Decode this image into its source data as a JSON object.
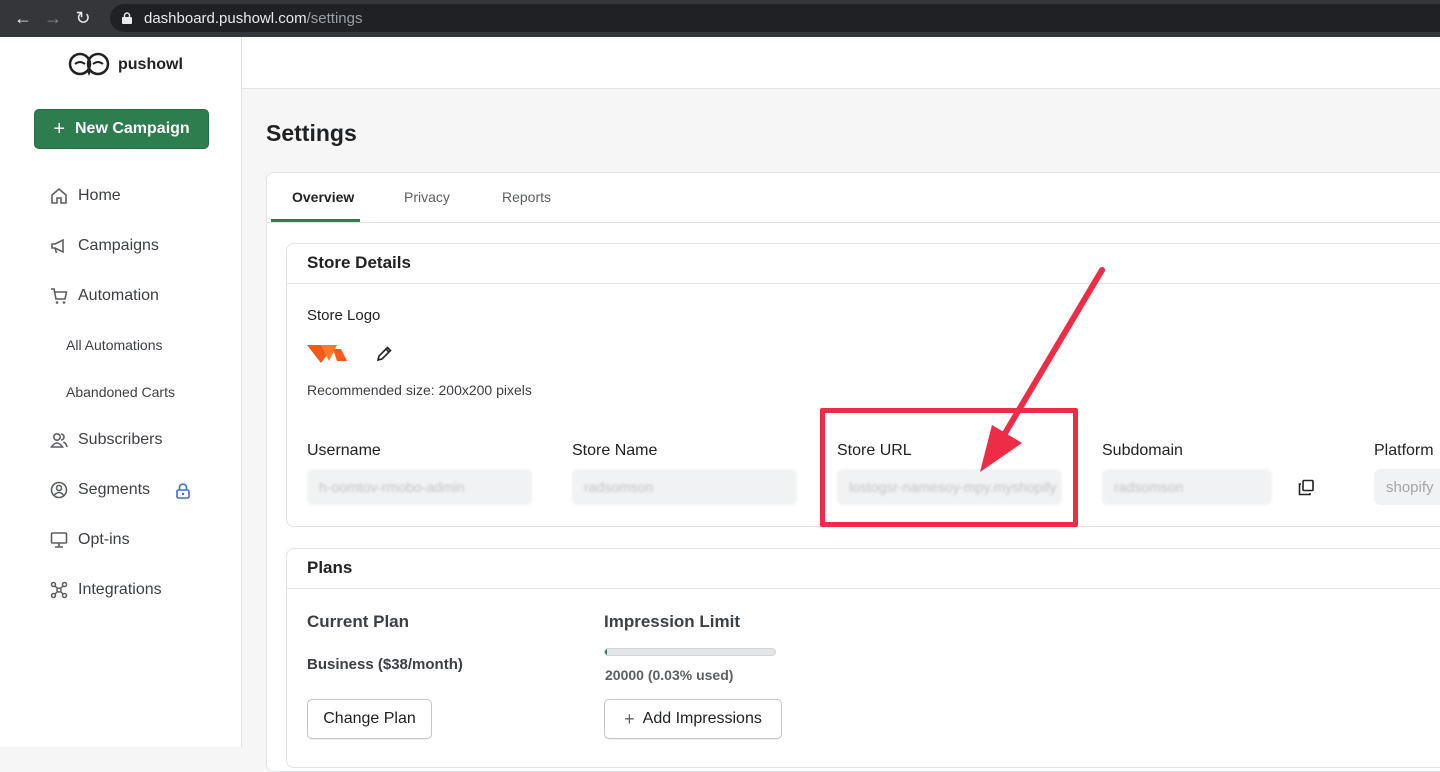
{
  "browser": {
    "url_host": "dashboard.pushowl.com",
    "url_path": "/settings"
  },
  "sidebar": {
    "logo_text": "pushowl",
    "new_campaign_label": "New Campaign",
    "items": [
      {
        "label": "Home",
        "icon": "home-icon"
      },
      {
        "label": "Campaigns",
        "icon": "megaphone-icon"
      },
      {
        "label": "Automation",
        "icon": "cart-icon"
      },
      {
        "label": "All Automations"
      },
      {
        "label": "Abandoned Carts"
      },
      {
        "label": "Subscribers",
        "icon": "people-icon"
      },
      {
        "label": "Segments",
        "icon": "user-circle-icon",
        "locked": true
      },
      {
        "label": "Opt-ins",
        "icon": "monitor-icon"
      },
      {
        "label": "Integrations",
        "icon": "nodes-icon"
      }
    ]
  },
  "page": {
    "title": "Settings",
    "tabs": [
      {
        "label": "Overview",
        "active": true
      },
      {
        "label": "Privacy"
      },
      {
        "label": "Reports"
      }
    ]
  },
  "store_details": {
    "header": "Store Details",
    "logo_label": "Store Logo",
    "logo_hint": "Recommended size: 200x200 pixels",
    "fields": [
      {
        "label": "Username",
        "value": "h-oomtov-rmobo-admin"
      },
      {
        "label": "Store Name",
        "value": "radsomson"
      },
      {
        "label": "Store URL",
        "value": "lostogsr-namesoy-mpy.myshopify"
      },
      {
        "label": "Subdomain",
        "value": "radsomson"
      },
      {
        "label": "Platform",
        "value": "shopify"
      }
    ]
  },
  "plans": {
    "header": "Plans",
    "current_plan_label": "Current Plan",
    "current_plan_value": "Business ($38/month)",
    "change_plan_button": "Change Plan",
    "impression_label": "Impression Limit",
    "impression_value": "20000 (0.03% used)",
    "impression_used_fraction": 0.0003,
    "add_impressions_button": "Add Impressions"
  },
  "colors": {
    "accent": "#2e7d4f",
    "annotation": "#ee2c45",
    "lock": "#3f6ad8"
  }
}
